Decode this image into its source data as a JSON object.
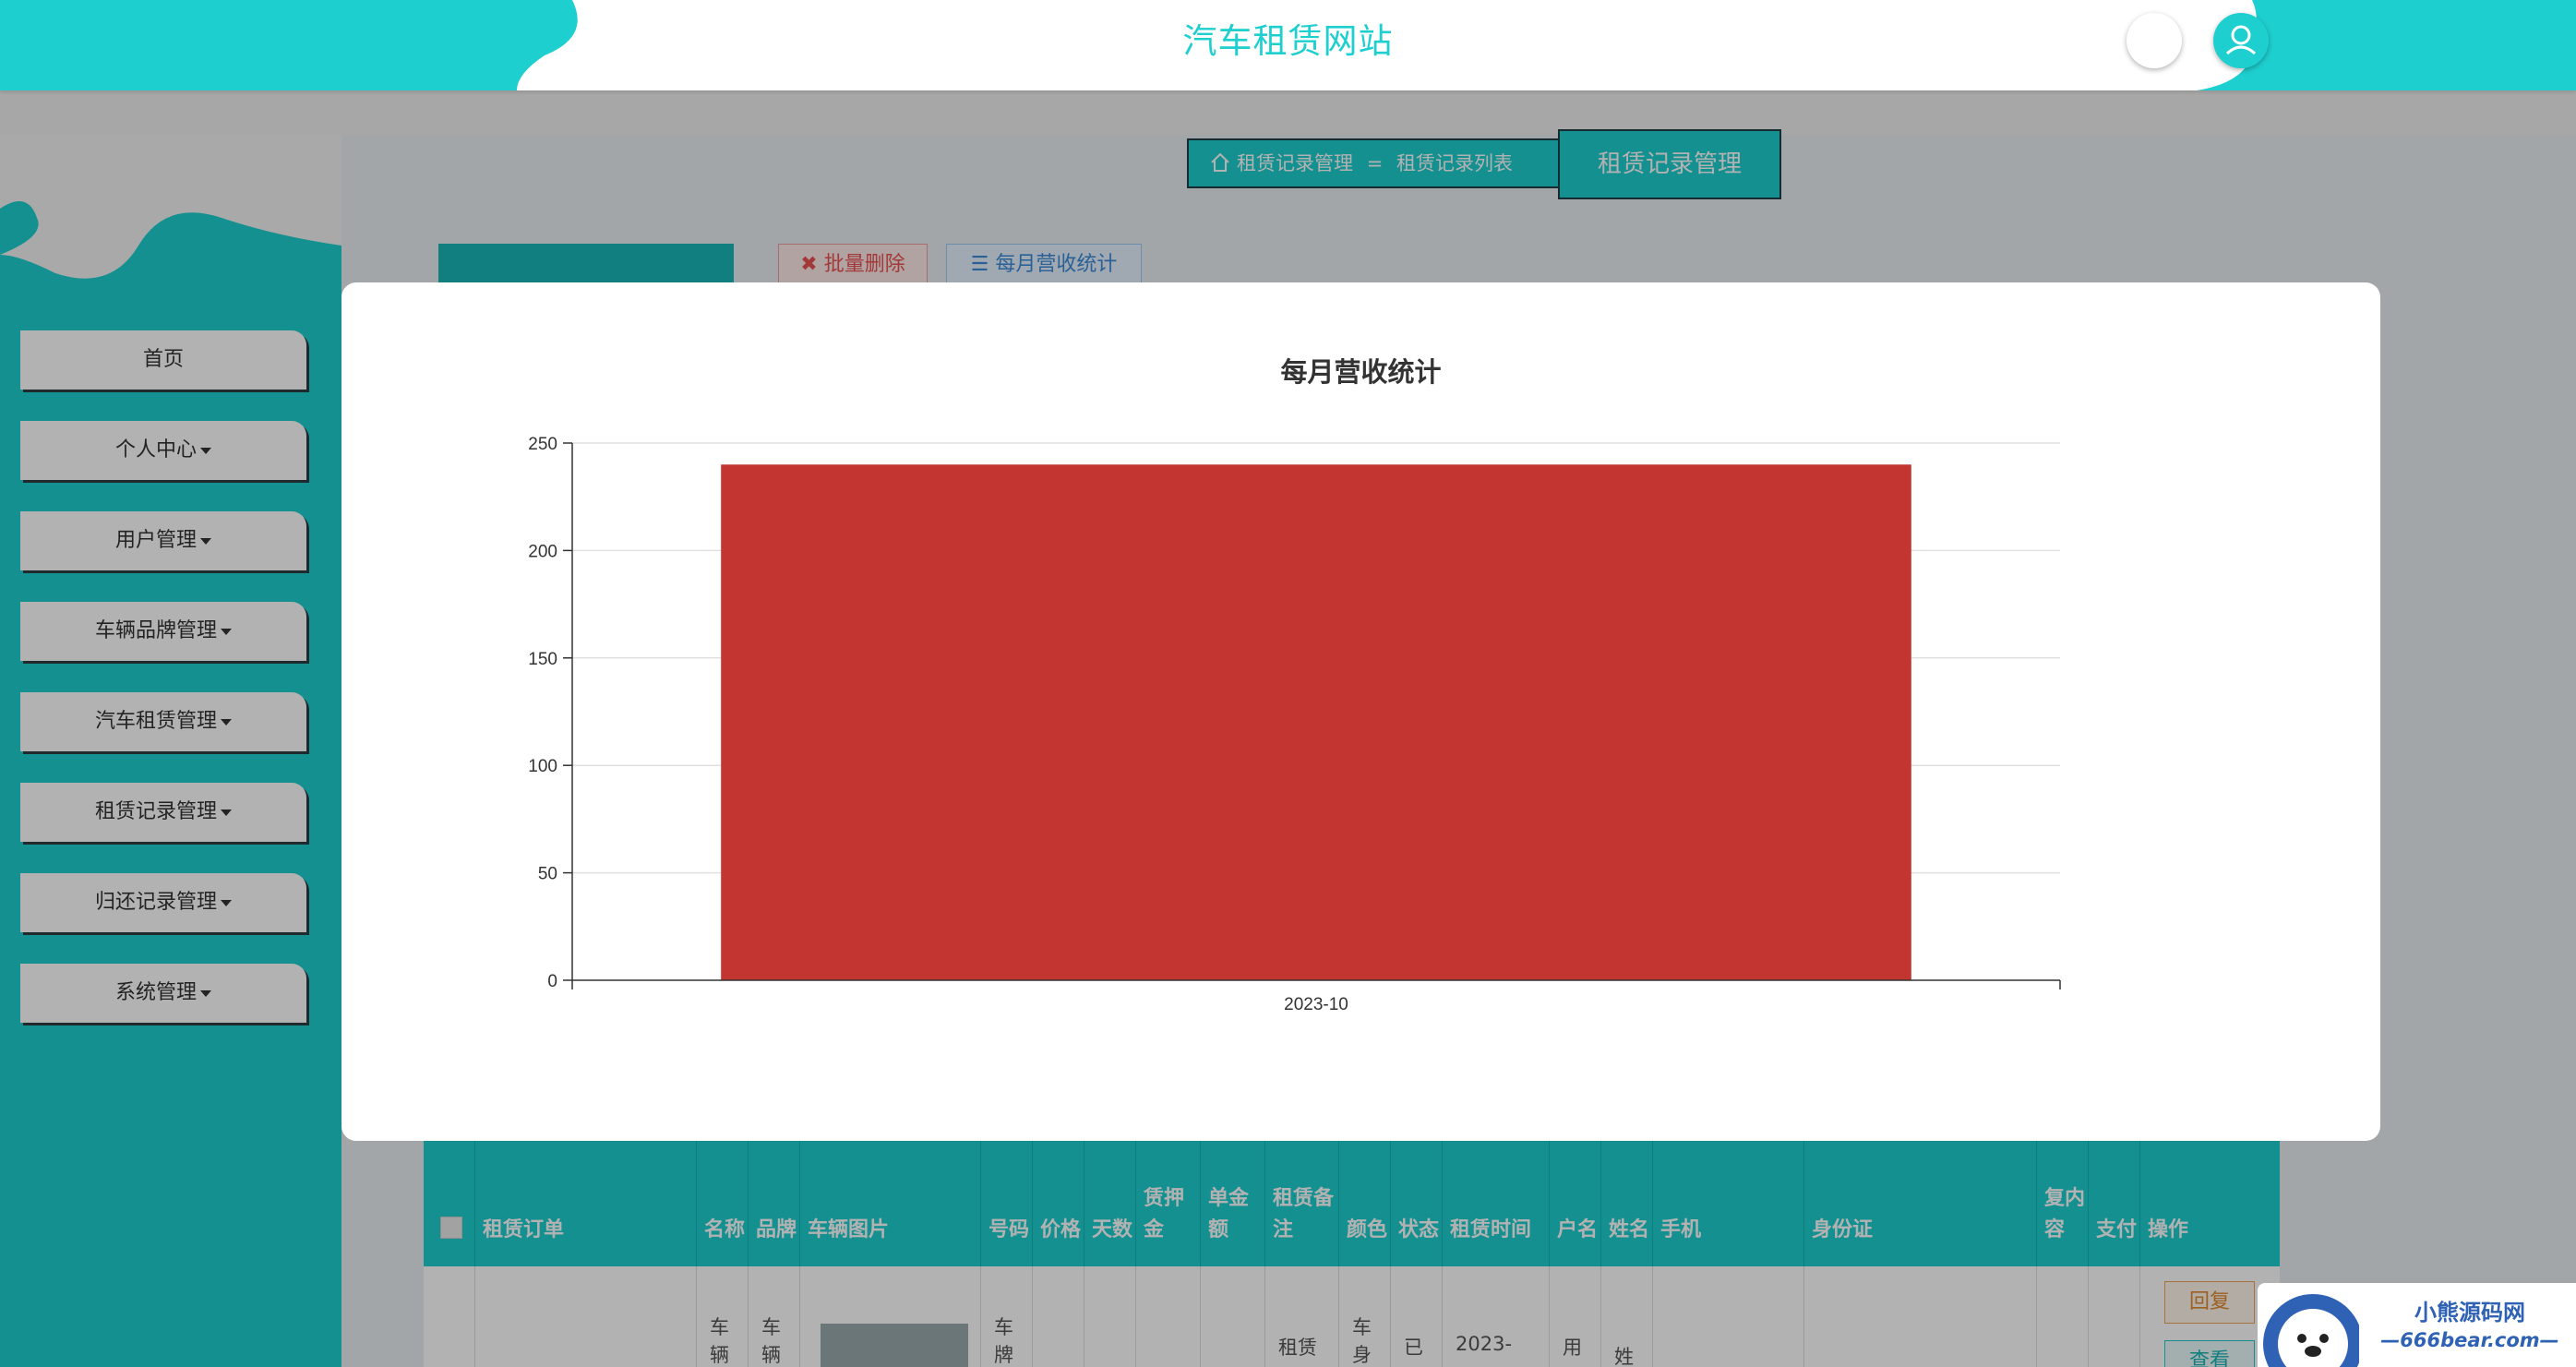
{
  "header": {
    "title": "汽车租赁网站"
  },
  "sidebar": {
    "items": [
      {
        "label": "首页",
        "dropdown": false
      },
      {
        "label": "个人中心",
        "dropdown": true
      },
      {
        "label": "用户管理",
        "dropdown": true
      },
      {
        "label": "车辆品牌管理",
        "dropdown": true
      },
      {
        "label": "汽车租赁管理",
        "dropdown": true
      },
      {
        "label": "租赁记录管理",
        "dropdown": true
      },
      {
        "label": "归还记录管理",
        "dropdown": true
      },
      {
        "label": "系统管理",
        "dropdown": true
      }
    ]
  },
  "breadcrumb": {
    "home": "租赁记录管理",
    "separator": "=",
    "current": "租赁记录列表",
    "title": "租赁记录管理"
  },
  "toolbar": {
    "batch_delete": "批量删除",
    "monthly_stats": "每月营收统计"
  },
  "table": {
    "headers": [
      "租赁订单",
      "名称",
      "品牌",
      "车辆图片",
      "号码",
      "价格",
      "天数",
      "赁押金",
      "单金额",
      "租赁备注",
      "颜色",
      "状态",
      "租赁时间",
      "户名",
      "姓名",
      "手机",
      "身份证",
      "复内容",
      "支付",
      "操作"
    ],
    "row": [
      "",
      "车辆",
      "车辆",
      "",
      "车牌",
      "",
      "",
      "",
      "",
      "租赁",
      "车身",
      "已",
      "2023-",
      "用",
      "姓",
      "",
      "",
      "",
      "",
      ""
    ],
    "actions": {
      "reply": "回复",
      "view": "查看"
    }
  },
  "chart_data": {
    "type": "bar",
    "title": "每月营收统计",
    "categories": [
      "2023-10"
    ],
    "values": [
      240
    ],
    "ylim": [
      0,
      250
    ],
    "yticks": [
      0,
      50,
      100,
      150,
      200,
      250
    ],
    "grid": true,
    "bar_color": "#c23531"
  },
  "watermark": {
    "line1": "小熊源码网",
    "line2": "—666bear.com—"
  },
  "colors": {
    "accent": "#1ecfcf",
    "bar": "#c23531"
  }
}
